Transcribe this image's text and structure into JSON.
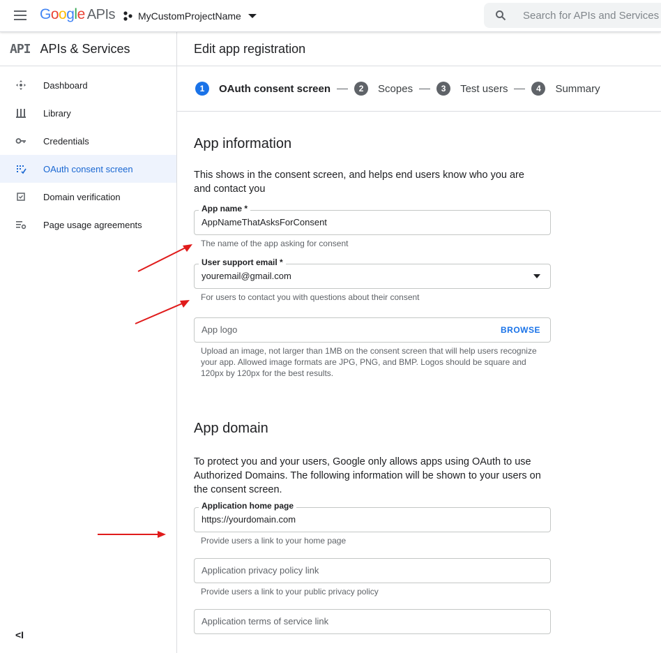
{
  "topbar": {
    "logo_google": "Google",
    "logo_apis": "APIs",
    "project_name": "MyCustomProjectName",
    "search_placeholder": "Search for APIs and Services"
  },
  "sidebar": {
    "api_mark": "API",
    "title": "APIs & Services",
    "items": [
      {
        "label": "Dashboard",
        "icon": "dashboard-icon"
      },
      {
        "label": "Library",
        "icon": "library-icon"
      },
      {
        "label": "Credentials",
        "icon": "key-icon"
      },
      {
        "label": "OAuth consent screen",
        "icon": "consent-icon",
        "active": true
      },
      {
        "label": "Domain verification",
        "icon": "checkbox-icon"
      },
      {
        "label": "Page usage agreements",
        "icon": "settings-list-icon"
      }
    ],
    "collapse_glyph": "<I"
  },
  "main": {
    "title": "Edit app registration",
    "steps": [
      {
        "num": "1",
        "label": "OAuth consent screen",
        "active": true
      },
      {
        "num": "2",
        "label": "Scopes"
      },
      {
        "num": "3",
        "label": "Test users"
      },
      {
        "num": "4",
        "label": "Summary"
      }
    ],
    "app_info": {
      "heading": "App information",
      "description": "This shows in the consent screen, and helps end users know who you are and contact you",
      "app_name_label": "App name *",
      "app_name_value": "AppNameThatAsksForConsent",
      "app_name_hint": "The name of the app asking for consent",
      "support_email_label": "User support email *",
      "support_email_value": "youremail@gmail.com",
      "support_email_hint": "For users to contact you with questions about their consent",
      "logo_placeholder": "App logo",
      "browse_label": "BROWSE",
      "logo_hint": "Upload an image, not larger than 1MB on the consent screen that will help users recognize your app. Allowed image formats are JPG, PNG, and BMP. Logos should be square and 120px by 120px for the best results."
    },
    "app_domain": {
      "heading": "App domain",
      "description": "To protect you and your users, Google only allows apps using OAuth to use Authorized Domains. The following information will be shown to your users on the consent screen.",
      "home_label": "Application home page",
      "home_value": "https://yourdomain.com",
      "home_hint": "Provide users a link to your home page",
      "privacy_placeholder": "Application privacy policy link",
      "privacy_hint": "Provide users a link to your public privacy policy",
      "tos_placeholder": "Application terms of service link"
    }
  },
  "colors": {
    "accent": "#1a73e8",
    "annotation_arrow": "#e01b1b",
    "active_nav_bg": "#eef3fd"
  }
}
